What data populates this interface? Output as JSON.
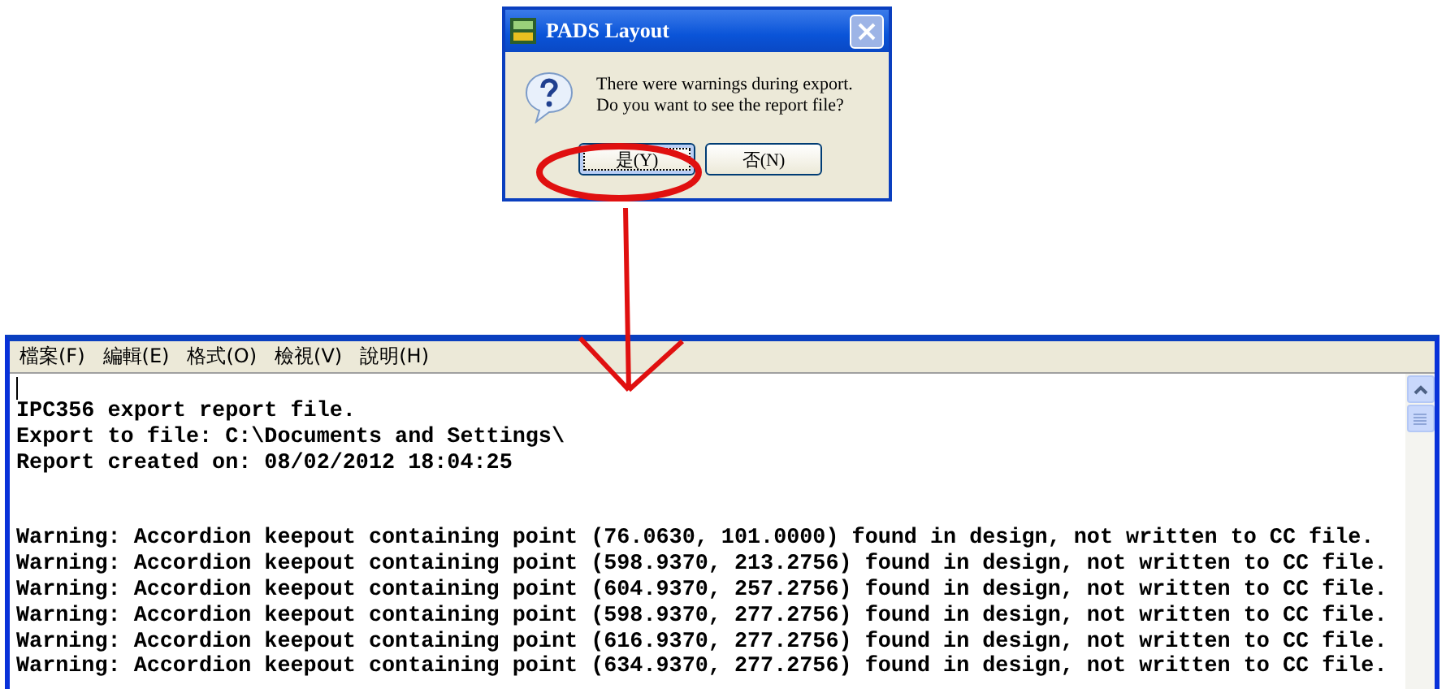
{
  "dialog": {
    "title": "PADS Layout",
    "message": [
      "There were warnings during export.",
      "Do you want to see the report file?"
    ],
    "buttons": [
      {
        "label": "是(Y)",
        "focused": true
      },
      {
        "label": "否(N)",
        "focused": false
      }
    ]
  },
  "notepad": {
    "menu": [
      "檔案(F)",
      "編輯(E)",
      "格式(O)",
      "檢視(V)",
      "說明(H)"
    ],
    "caret": true,
    "header_lines": [
      "IPC356 export report file.",
      "Export to file: C:\\Documents and Settings\\",
      "Report created on: 08/02/2012 18:04:25"
    ],
    "warnings": [
      "Warning: Accordion keepout containing point (76.0630, 101.0000) found in design, not written to CC file.",
      "Warning: Accordion keepout containing point (598.9370, 213.2756) found in design, not written to CC file.",
      "Warning: Accordion keepout containing point (604.9370, 257.2756) found in design, not written to CC file.",
      "Warning: Accordion keepout containing point (598.9370, 277.2756) found in design, not written to CC file.",
      "Warning: Accordion keepout containing point (616.9370, 277.2756) found in design, not written to CC file.",
      "Warning: Accordion keepout containing point (634.9370, 277.2756) found in design, not written to CC file."
    ]
  }
}
